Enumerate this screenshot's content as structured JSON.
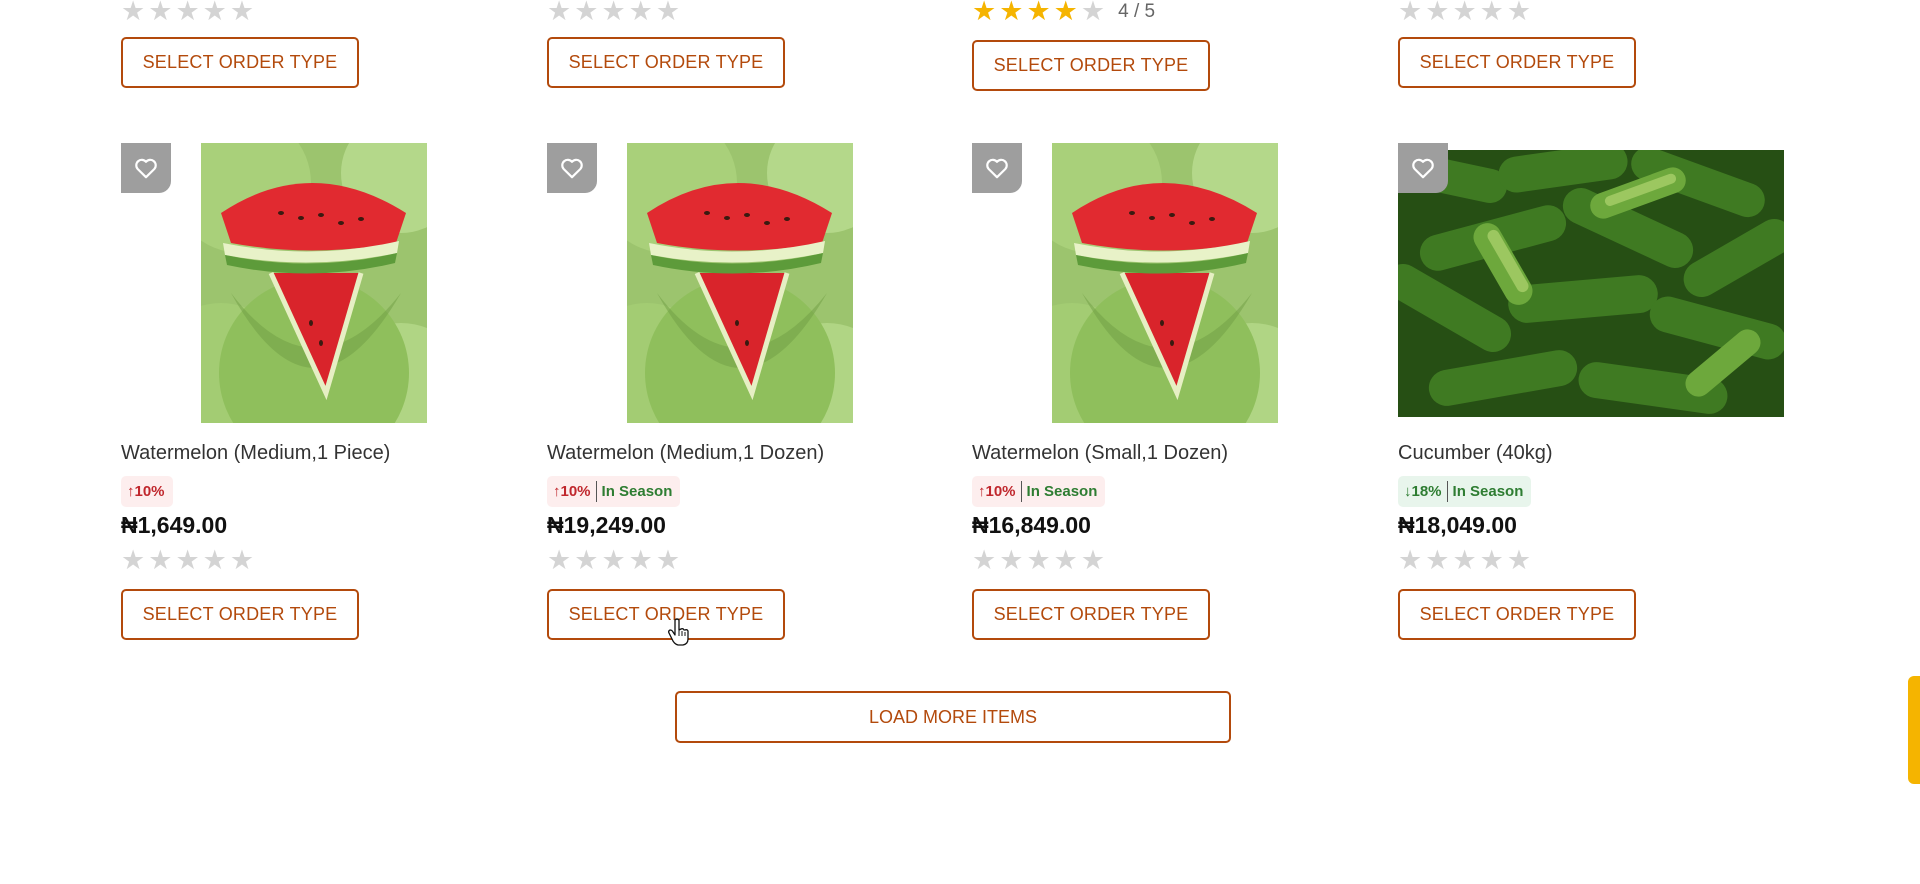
{
  "colors": {
    "accent": "#b34a0c",
    "star_on": "#f5b400",
    "star_off": "#d4d4d4",
    "up": "#c0272d",
    "down": "#2e7d32"
  },
  "top_row": [
    {
      "rating": 0,
      "button": "SELECT ORDER TYPE"
    },
    {
      "rating": 0,
      "button": "SELECT ORDER TYPE"
    },
    {
      "rating": 4,
      "rating_text": "4 / 5",
      "button": "SELECT ORDER TYPE"
    },
    {
      "rating": 0,
      "button": "SELECT ORDER TYPE"
    }
  ],
  "products": [
    {
      "title": "Watermelon (Medium,1 Piece)",
      "change_dir": "up",
      "change_arrow": "↑",
      "change": "10%",
      "season": "",
      "price": "₦1,649.00",
      "rating": 0,
      "button": "SELECT ORDER TYPE",
      "image": "watermelon-image"
    },
    {
      "title": "Watermelon (Medium,1 Dozen)",
      "change_dir": "up",
      "change_arrow": "↑",
      "change": "10%",
      "season": "In Season",
      "price": "₦19,249.00",
      "rating": 0,
      "button": "SELECT ORDER TYPE",
      "image": "watermelon-image"
    },
    {
      "title": "Watermelon (Small,1 Dozen)",
      "change_dir": "up",
      "change_arrow": "↑",
      "change": "10%",
      "season": "In Season",
      "price": "₦16,849.00",
      "rating": 0,
      "button": "SELECT ORDER TYPE",
      "image": "watermelon-image"
    },
    {
      "title": "Cucumber (40kg)",
      "change_dir": "down",
      "change_arrow": "↓",
      "change": "18%",
      "season": "In Season",
      "price": "₦18,049.00",
      "rating": 0,
      "button": "SELECT ORDER TYPE",
      "image": "cucumber-image"
    }
  ],
  "load_more": "LOAD MORE ITEMS",
  "icons": {
    "favorite": "heart-icon",
    "rating": "star-icon",
    "cursor": "hand-pointer-icon"
  }
}
